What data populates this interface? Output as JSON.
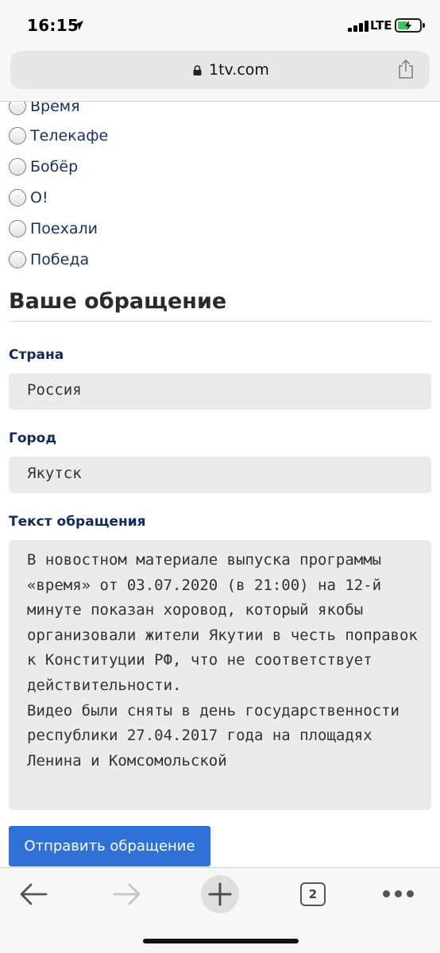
{
  "status_bar": {
    "time": "16:15",
    "network": "LTE",
    "icons": [
      "location-arrow-icon",
      "signal-icon",
      "battery-charging-icon"
    ]
  },
  "browser": {
    "url": "1tv.com",
    "icons": [
      "lock-icon",
      "share-icon"
    ]
  },
  "radio_options": [
    {
      "label": "Время",
      "selected": false
    },
    {
      "label": "Телекафе",
      "selected": false
    },
    {
      "label": "Бобёр",
      "selected": false
    },
    {
      "label": "О!",
      "selected": false
    },
    {
      "label": "Поехали",
      "selected": false
    },
    {
      "label": "Победа",
      "selected": false
    }
  ],
  "form": {
    "section_title": "Ваше обращение",
    "country": {
      "label": "Страна",
      "value": "Россия"
    },
    "city": {
      "label": "Город",
      "value": "Якутск"
    },
    "message": {
      "label": "Текст обращения",
      "value": "В новостном материале выпуска программы «время» от 03.07.2020 (в 21:00) на 12-й минуте показан хоровод, который якобы организовали жители Якутии в честь поправок к Конституции РФ, что не соответствует действительности.\nВидео были сняты в день государственности республики 27.04.2017 года на площадях Ленина и Комсомольской"
    },
    "submit_label": "Отправить обращение",
    "colors": {
      "button": "#2f71d6",
      "label": "#13295a"
    }
  },
  "toolbar": {
    "tab_count": "2",
    "icons": [
      "back-arrow-icon",
      "forward-arrow-icon",
      "new-tab-plus-icon",
      "tabs-icon",
      "more-dots-icon"
    ]
  }
}
